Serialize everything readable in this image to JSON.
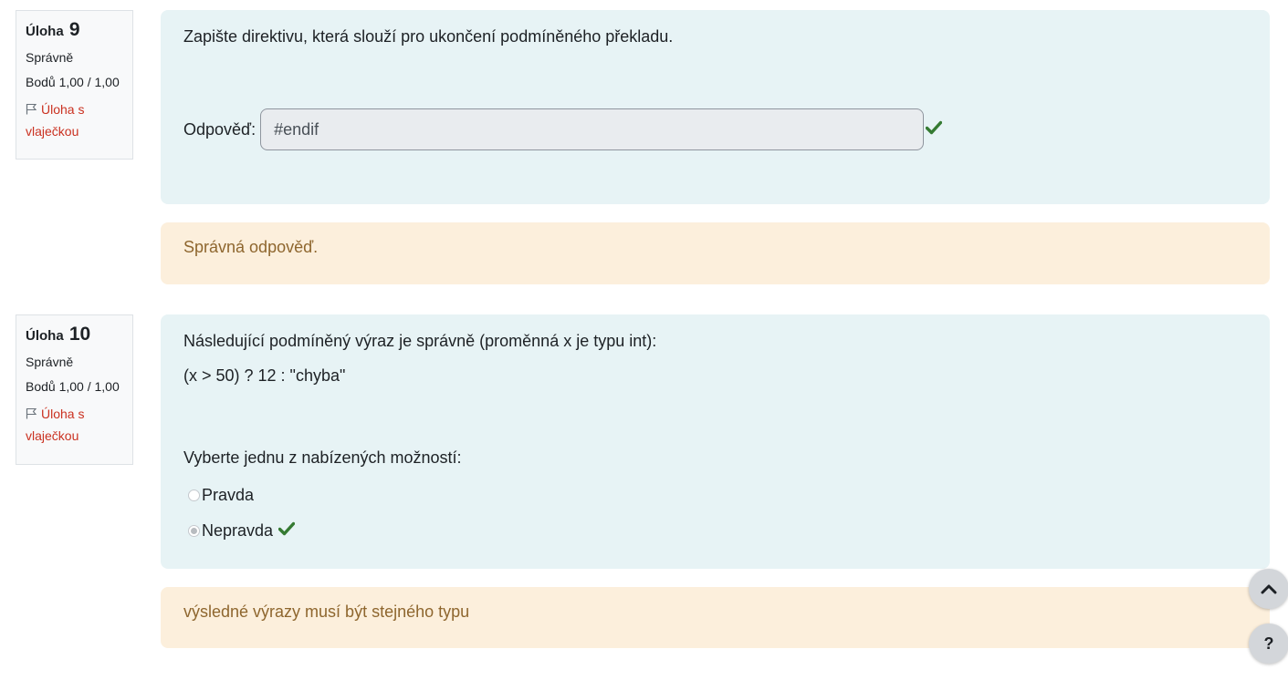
{
  "questions": [
    {
      "prefix": "Úloha",
      "number": "9",
      "state": "Správně",
      "grade": "Bodů 1,00 / 1,00",
      "flag_label": "Úloha s vlaječkou",
      "text": "Zapište direktivu, která slouží pro ukončení podmíněného překladu.",
      "answer_label": "Odpověď:",
      "answer_value": "#endif",
      "feedback": "Správná odpověď."
    },
    {
      "prefix": "Úloha",
      "number": "10",
      "state": "Správně",
      "grade": "Bodů 1,00 / 1,00",
      "flag_label": "Úloha s vlaječkou",
      "text": "Následující podmíněný výraz je správně (proměnná x je typu int):",
      "code": "(x > 50) ? 12 : \"chyba\"",
      "prompt": "Vyberte jednu z nabízených možností:",
      "options": [
        "Pravda",
        "Nepravda"
      ],
      "selected_option": "Nepravda",
      "feedback": "výsledné výrazy musí být stejného typu"
    }
  ],
  "buttons": {
    "scroll_top_icon": "chevron-up-icon",
    "help_label": "?"
  },
  "colors": {
    "formulation_bg": "#e7f3f5",
    "feedback_bg": "#fcefdc",
    "feedback_text": "#8e662e",
    "flag": "#ca3120",
    "correct": "#357a32"
  }
}
